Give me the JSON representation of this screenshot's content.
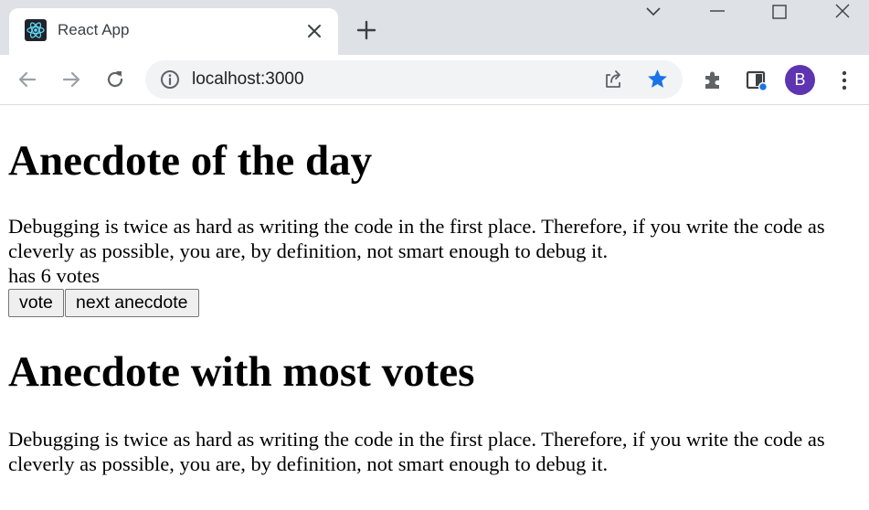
{
  "browser": {
    "tab": {
      "title": "React App",
      "favicon": "react-logo-icon"
    },
    "window_controls": [
      "chevron-down-icon",
      "minimize-icon",
      "maximize-icon",
      "close-icon"
    ],
    "address_bar": {
      "url": "localhost:3000"
    },
    "profile": {
      "initial": "B",
      "color": "#5e35b1"
    },
    "accent_color": "#1a73e8"
  },
  "page": {
    "heading_day": "Anecdote of the day",
    "anecdote_day": "Debugging is twice as hard as writing the code in the first place. Therefore, if you write the code as cleverly as possible, you are, by definition, not smart enough to debug it.",
    "votes_text": "has 6 votes",
    "vote_button": "vote",
    "next_button": "next anecdote",
    "heading_most": "Anecdote with most votes",
    "anecdote_most": "Debugging is twice as hard as writing the code in the first place. Therefore, if you write the code as cleverly as possible, you are, by definition, not smart enough to debug it."
  }
}
